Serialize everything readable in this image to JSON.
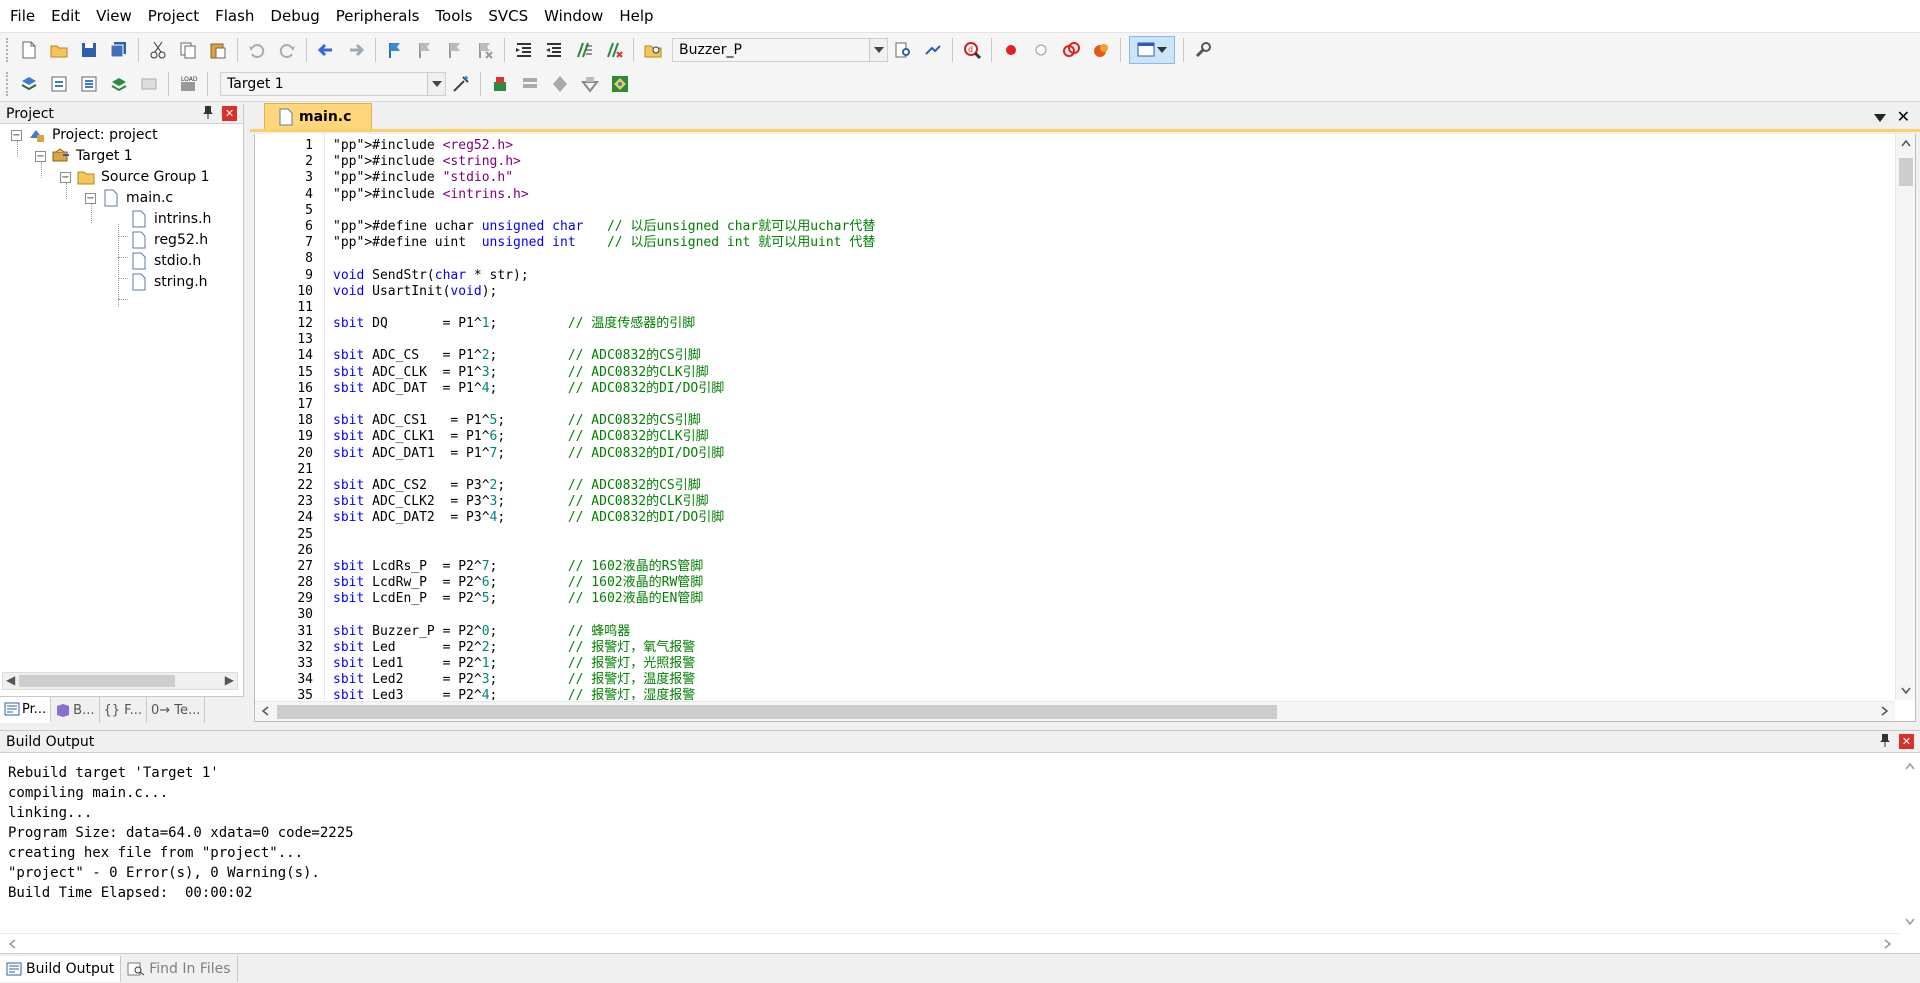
{
  "menu": [
    "File",
    "Edit",
    "View",
    "Project",
    "Flash",
    "Debug",
    "Peripherals",
    "Tools",
    "SVCS",
    "Window",
    "Help"
  ],
  "toolbar1": {
    "buzzer_value": "Buzzer_P"
  },
  "toolbar2": {
    "target_value": "Target 1"
  },
  "project_pane": {
    "title": "Project",
    "tree": [
      {
        "label": "Project: project",
        "level": 0,
        "kind": "project"
      },
      {
        "label": "Target 1",
        "level": 1,
        "kind": "target"
      },
      {
        "label": "Source Group 1",
        "level": 2,
        "kind": "folder"
      },
      {
        "label": "main.c",
        "level": 3,
        "kind": "file"
      },
      {
        "label": "intrins.h",
        "level": 4,
        "kind": "file"
      },
      {
        "label": "reg52.h",
        "level": 4,
        "kind": "file"
      },
      {
        "label": "stdio.h",
        "level": 4,
        "kind": "file"
      },
      {
        "label": "string.h",
        "level": 4,
        "kind": "file"
      }
    ],
    "tabs": [
      "Pr...",
      "B...",
      "{} F...",
      "0→ Te..."
    ]
  },
  "editor": {
    "tab_label": "main.c",
    "lines": [
      "#include <reg52.h>",
      "#include <string.h>",
      "#include \"stdio.h\"",
      "#include <intrins.h>",
      "",
      "#define uchar unsigned char   // 以后unsigned char就可以用uchar代替",
      "#define uint  unsigned int    // 以后unsigned int 就可以用uint 代替",
      "",
      "void SendStr(char * str);",
      "void UsartInit(void);",
      "",
      "sbit DQ       = P1^1;         // 温度传感器的引脚",
      "",
      "sbit ADC_CS   = P1^2;         // ADC0832的CS引脚",
      "sbit ADC_CLK  = P1^3;         // ADC0832的CLK引脚",
      "sbit ADC_DAT  = P1^4;         // ADC0832的DI/DO引脚",
      "",
      "sbit ADC_CS1   = P1^5;        // ADC0832的CS引脚",
      "sbit ADC_CLK1  = P1^6;        // ADC0832的CLK引脚",
      "sbit ADC_DAT1  = P1^7;        // ADC0832的DI/DO引脚",
      "",
      "sbit ADC_CS2   = P3^2;        // ADC0832的CS引脚",
      "sbit ADC_CLK2  = P3^3;        // ADC0832的CLK引脚",
      "sbit ADC_DAT2  = P3^4;        // ADC0832的DI/DO引脚",
      "",
      "",
      "sbit LcdRs_P  = P2^7;         // 1602液晶的RS管脚",
      "sbit LcdRw_P  = P2^6;         // 1602液晶的RW管脚",
      "sbit LcdEn_P  = P2^5;         // 1602液晶的EN管脚",
      "",
      "sbit Buzzer_P = P2^0;         // 蜂鸣器",
      "sbit Led      = P2^2;         // 报警灯，氧气报警",
      "sbit Led1     = P2^1;         // 报警灯，光照报警",
      "sbit Led2     = P2^3;         // 报警灯，温度报警",
      "sbit Led3     = P2^4;         // 报警灯，湿度报警"
    ]
  },
  "build_output": {
    "title": "Build Output",
    "lines": [
      "Rebuild target 'Target 1'",
      "compiling main.c...",
      "linking...",
      "Program Size: data=64.0 xdata=0 code=2225",
      "creating hex file from \"project\"...",
      "\"project\" - 0 Error(s), 0 Warning(s).",
      "Build Time Elapsed:  00:00:02"
    ],
    "tabs": [
      "Build Output",
      "Find In Files"
    ]
  }
}
